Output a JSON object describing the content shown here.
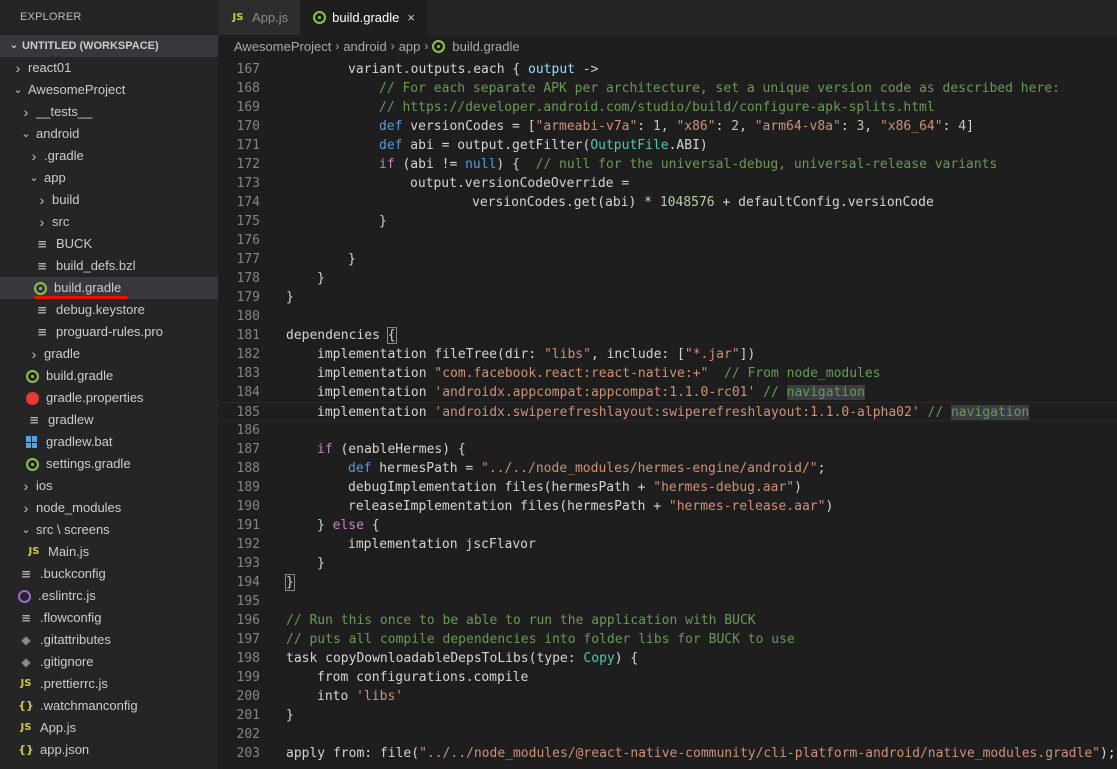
{
  "sidebar": {
    "title": "EXPLORER",
    "workspace": "UNTITLED (WORKSPACE)",
    "tree": [
      {
        "label": "react01",
        "depth": 1,
        "kind": "folder",
        "open": false
      },
      {
        "label": "AwesomeProject",
        "depth": 1,
        "kind": "folder",
        "open": true
      },
      {
        "label": "__tests__",
        "depth": 2,
        "kind": "folder",
        "open": false
      },
      {
        "label": "android",
        "depth": 2,
        "kind": "folder",
        "open": true
      },
      {
        "label": ".gradle",
        "depth": 3,
        "kind": "folder",
        "open": false
      },
      {
        "label": "app",
        "depth": 3,
        "kind": "folder",
        "open": true
      },
      {
        "label": "build",
        "depth": 4,
        "kind": "folder",
        "open": false
      },
      {
        "label": "src",
        "depth": 4,
        "kind": "folder",
        "open": false
      },
      {
        "label": "BUCK",
        "depth": 4,
        "kind": "lines"
      },
      {
        "label": "build_defs.bzl",
        "depth": 4,
        "kind": "lines"
      },
      {
        "label": "build.gradle",
        "depth": 4,
        "kind": "gradle",
        "selected": true
      },
      {
        "label": "debug.keystore",
        "depth": 4,
        "kind": "lines"
      },
      {
        "label": "proguard-rules.pro",
        "depth": 4,
        "kind": "lines"
      },
      {
        "label": "gradle",
        "depth": 3,
        "kind": "folder",
        "open": false
      },
      {
        "label": "build.gradle",
        "depth": 3,
        "kind": "gradle"
      },
      {
        "label": "gradle.properties",
        "depth": 3,
        "kind": "props"
      },
      {
        "label": "gradlew",
        "depth": 3,
        "kind": "lines"
      },
      {
        "label": "gradlew.bat",
        "depth": 3,
        "kind": "win"
      },
      {
        "label": "settings.gradle",
        "depth": 3,
        "kind": "gradle"
      },
      {
        "label": "ios",
        "depth": 2,
        "kind": "folder",
        "open": false
      },
      {
        "label": "node_modules",
        "depth": 2,
        "kind": "folder",
        "open": false
      },
      {
        "label": "src \\ screens",
        "depth": 2,
        "kind": "folder",
        "open": true
      },
      {
        "label": "Main.js",
        "depth": 3,
        "kind": "js"
      },
      {
        "label": ".buckconfig",
        "depth": 2,
        "kind": "lines"
      },
      {
        "label": ".eslintrc.js",
        "depth": 2,
        "kind": "eslint"
      },
      {
        "label": ".flowconfig",
        "depth": 2,
        "kind": "lines"
      },
      {
        "label": ".gitattributes",
        "depth": 2,
        "kind": "diamond"
      },
      {
        "label": ".gitignore",
        "depth": 2,
        "kind": "diamond"
      },
      {
        "label": ".prettierrc.js",
        "depth": 2,
        "kind": "js"
      },
      {
        "label": ".watchmanconfig",
        "depth": 2,
        "kind": "braces"
      },
      {
        "label": "App.js",
        "depth": 2,
        "kind": "js"
      },
      {
        "label": "app.json",
        "depth": 2,
        "kind": "braces"
      }
    ]
  },
  "tabs": [
    {
      "label": "App.js",
      "icon": "js-icon",
      "active": false
    },
    {
      "label": "build.gradle",
      "icon": "gradle-icon",
      "active": true
    }
  ],
  "breadcrumb": [
    "AwesomeProject",
    "android",
    "app",
    "build.gradle"
  ],
  "icons": {
    "js": "JS",
    "lines": "≡",
    "diamond": "◆",
    "braces": "{}",
    "chevron_right": "›",
    "chevron_down": "⌄",
    "close": "×"
  },
  "colors": {
    "keyword": "#569cd6",
    "control": "#c586c0",
    "string": "#ce9178",
    "number": "#b5cea8",
    "comment": "#6a9955",
    "type": "#4ec9b0",
    "variable": "#9cdcfe",
    "selection_underline": "#e51400"
  },
  "code": [
    {
      "n": "167",
      "indent": 2,
      "tokens": [
        [
          "",
          "variant.outputs.each { "
        ],
        [
          "var",
          "output"
        ],
        [
          "",
          " ->"
        ]
      ]
    },
    {
      "n": "168",
      "indent": 3,
      "tokens": [
        [
          "cmt",
          "// For each separate APK per architecture, set a unique version code as described here:"
        ]
      ]
    },
    {
      "n": "169",
      "indent": 3,
      "tokens": [
        [
          "cmt",
          "// https://developer.android.com/studio/build/configure-apk-splits.html"
        ]
      ]
    },
    {
      "n": "170",
      "indent": 3,
      "tokens": [
        [
          "kw",
          "def"
        ],
        [
          "",
          " versionCodes = ["
        ],
        [
          "str",
          "\"armeabi-v7a\""
        ],
        [
          "",
          ": "
        ],
        [
          "num",
          "1"
        ],
        [
          "",
          ", "
        ],
        [
          "str",
          "\"x86\""
        ],
        [
          "",
          ": "
        ],
        [
          "num",
          "2"
        ],
        [
          "",
          ", "
        ],
        [
          "str",
          "\"arm64-v8a\""
        ],
        [
          "",
          ": "
        ],
        [
          "num",
          "3"
        ],
        [
          "",
          ", "
        ],
        [
          "str",
          "\"x86_64\""
        ],
        [
          "",
          ": "
        ],
        [
          "num",
          "4"
        ],
        [
          "",
          "]"
        ]
      ]
    },
    {
      "n": "171",
      "indent": 3,
      "tokens": [
        [
          "kw",
          "def"
        ],
        [
          "",
          " abi = output.getFilter("
        ],
        [
          "typ",
          "OutputFile"
        ],
        [
          "",
          ".ABI)"
        ]
      ]
    },
    {
      "n": "172",
      "indent": 3,
      "tokens": [
        [
          "ctl",
          "if"
        ],
        [
          "",
          " (abi != "
        ],
        [
          "kw",
          "null"
        ],
        [
          "",
          ") {  "
        ],
        [
          "cmt",
          "// null for the universal-debug, universal-release variants"
        ]
      ]
    },
    {
      "n": "173",
      "indent": 4,
      "tokens": [
        [
          "",
          "output.versionCodeOverride ="
        ]
      ]
    },
    {
      "n": "174",
      "indent": 6,
      "tokens": [
        [
          "",
          "versionCodes.get(abi) * "
        ],
        [
          "num",
          "1048576"
        ],
        [
          "",
          " + defaultConfig.versionCode"
        ]
      ]
    },
    {
      "n": "175",
      "indent": 3,
      "tokens": [
        [
          "",
          "}"
        ]
      ]
    },
    {
      "n": "176",
      "indent": 0,
      "tokens": []
    },
    {
      "n": "177",
      "indent": 2,
      "tokens": [
        [
          "",
          "}"
        ]
      ]
    },
    {
      "n": "178",
      "indent": 1,
      "tokens": [
        [
          "",
          "}"
        ]
      ]
    },
    {
      "n": "179",
      "indent": 0,
      "tokens": [
        [
          "",
          "}"
        ]
      ]
    },
    {
      "n": "180",
      "indent": 0,
      "tokens": []
    },
    {
      "n": "181",
      "indent": 0,
      "tokens": [
        [
          "",
          "dependencies "
        ],
        [
          "bracket",
          "{"
        ]
      ]
    },
    {
      "n": "182",
      "indent": 1,
      "tokens": [
        [
          "",
          "implementation fileTree(dir: "
        ],
        [
          "str",
          "\"libs\""
        ],
        [
          "",
          ", include: ["
        ],
        [
          "str",
          "\"*.jar\""
        ],
        [
          "",
          "])"
        ]
      ]
    },
    {
      "n": "183",
      "indent": 1,
      "tokens": [
        [
          "",
          "implementation "
        ],
        [
          "str",
          "\"com.facebook.react:react-native:+\""
        ],
        [
          "",
          "  "
        ],
        [
          "cmt",
          "// From node_modules"
        ]
      ]
    },
    {
      "n": "184",
      "indent": 1,
      "tokens": [
        [
          "",
          "implementation "
        ],
        [
          "str",
          "'androidx.appcompat:appcompat:1.1.0-rc01'"
        ],
        [
          "",
          " "
        ],
        [
          "cmt",
          "// "
        ],
        [
          "cmthl",
          "navigation"
        ]
      ]
    },
    {
      "n": "185",
      "indent": 1,
      "current": true,
      "tokens": [
        [
          "",
          "implementation "
        ],
        [
          "str",
          "'androidx.swiperefreshlayout:swiperefreshlayout:1.1.0-alpha02'"
        ],
        [
          "",
          " "
        ],
        [
          "cmt",
          "// "
        ],
        [
          "cmthl",
          "navigation"
        ]
      ]
    },
    {
      "n": "186",
      "indent": 0,
      "tokens": []
    },
    {
      "n": "187",
      "indent": 1,
      "tokens": [
        [
          "ctl",
          "if"
        ],
        [
          "",
          " (enableHermes) {"
        ]
      ]
    },
    {
      "n": "188",
      "indent": 2,
      "tokens": [
        [
          "kw",
          "def"
        ],
        [
          "",
          " hermesPath = "
        ],
        [
          "str",
          "\"../../node_modules/hermes-engine/android/\""
        ],
        [
          "",
          ";"
        ]
      ]
    },
    {
      "n": "189",
      "indent": 2,
      "tokens": [
        [
          "",
          "debugImplementation files(hermesPath + "
        ],
        [
          "str",
          "\"hermes-debug.aar\""
        ],
        [
          "",
          ")"
        ]
      ]
    },
    {
      "n": "190",
      "indent": 2,
      "tokens": [
        [
          "",
          "releaseImplementation files(hermesPath + "
        ],
        [
          "str",
          "\"hermes-release.aar\""
        ],
        [
          "",
          ")"
        ]
      ]
    },
    {
      "n": "191",
      "indent": 1,
      "tokens": [
        [
          "",
          "} "
        ],
        [
          "ctl",
          "else"
        ],
        [
          "",
          " {"
        ]
      ]
    },
    {
      "n": "192",
      "indent": 2,
      "tokens": [
        [
          "",
          "implementation jscFlavor"
        ]
      ]
    },
    {
      "n": "193",
      "indent": 1,
      "tokens": [
        [
          "",
          "}"
        ]
      ]
    },
    {
      "n": "194",
      "indent": 0,
      "tokens": [
        [
          "bracket",
          "}"
        ]
      ]
    },
    {
      "n": "195",
      "indent": 0,
      "tokens": []
    },
    {
      "n": "196",
      "indent": 0,
      "tokens": [
        [
          "cmt",
          "// Run this once to be able to run the application with BUCK"
        ]
      ]
    },
    {
      "n": "197",
      "indent": 0,
      "tokens": [
        [
          "cmt",
          "// puts all compile dependencies into folder libs for BUCK to use"
        ]
      ]
    },
    {
      "n": "198",
      "indent": 0,
      "tokens": [
        [
          "",
          "task copyDownloadableDepsToLibs(type: "
        ],
        [
          "typ",
          "Copy"
        ],
        [
          "",
          ") {"
        ]
      ]
    },
    {
      "n": "199",
      "indent": 1,
      "tokens": [
        [
          "",
          "from configurations.compile"
        ]
      ]
    },
    {
      "n": "200",
      "indent": 1,
      "tokens": [
        [
          "",
          "into "
        ],
        [
          "str",
          "'libs'"
        ]
      ]
    },
    {
      "n": "201",
      "indent": 0,
      "tokens": [
        [
          "",
          "}"
        ]
      ]
    },
    {
      "n": "202",
      "indent": 0,
      "tokens": []
    },
    {
      "n": "203",
      "indent": 0,
      "tokens": [
        [
          "",
          "apply from: file("
        ],
        [
          "str",
          "\"../../node_modules/@react-native-community/cli-platform-android/native_modules.gradle\""
        ],
        [
          "",
          "); a"
        ]
      ]
    }
  ]
}
